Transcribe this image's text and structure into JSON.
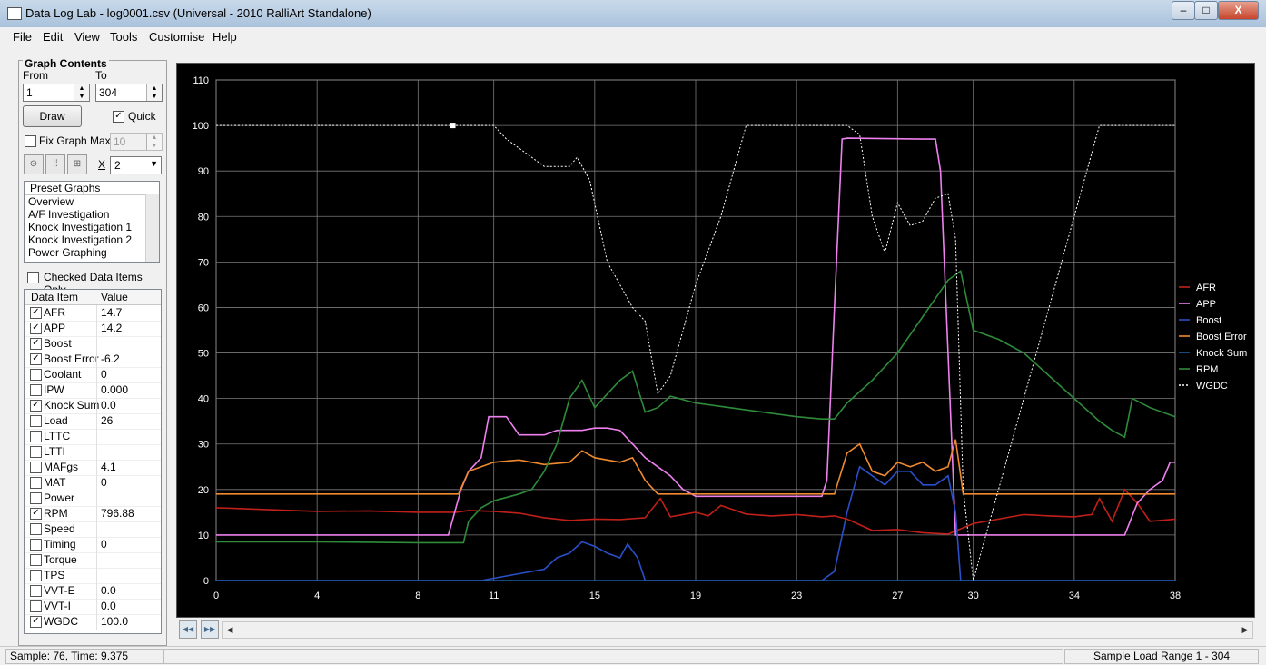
{
  "window": {
    "title": "Data Log Lab - log0001.csv (Universal - 2010 RalliArt Standalone)",
    "min_label": "–",
    "max_label": "□",
    "close_label": "X"
  },
  "menu": [
    "File",
    "Edit",
    "View",
    "Tools",
    "Customise",
    "Help"
  ],
  "graph_contents": {
    "title": "Graph Contents",
    "from_label": "From",
    "from_value": "1",
    "to_label": "To",
    "to_value": "304",
    "draw_label": "Draw",
    "quick_label": "Quick",
    "quick_checked": true,
    "fix_graph_max_label": "Fix Graph Max",
    "fix_graph_max_checked": false,
    "fix_graph_max_value": "10",
    "x_label": "X",
    "x_value": "2",
    "preset_header": "Preset Graphs",
    "presets": [
      "Overview",
      "A/F Investigation",
      "Knock Investigation 1",
      "Knock Investigation 2",
      "Power Graphing"
    ],
    "checked_only_label": "Checked Data Items Only",
    "checked_only": false
  },
  "table": {
    "col_item": "Data Item",
    "col_value": "Value",
    "rows": [
      {
        "name": "AFR",
        "checked": true,
        "value": "14.7"
      },
      {
        "name": "APP",
        "checked": true,
        "value": "14.2"
      },
      {
        "name": "Boost",
        "checked": true,
        "value": ""
      },
      {
        "name": "Boost Error",
        "checked": true,
        "value": "-6.2"
      },
      {
        "name": "Coolant",
        "checked": false,
        "value": "0"
      },
      {
        "name": "IPW",
        "checked": false,
        "value": "0.000"
      },
      {
        "name": "Knock Sum",
        "checked": true,
        "value": "0.0"
      },
      {
        "name": "Load",
        "checked": false,
        "value": "26"
      },
      {
        "name": "LTTC",
        "checked": false,
        "value": ""
      },
      {
        "name": "LTTI",
        "checked": false,
        "value": ""
      },
      {
        "name": "MAFgs",
        "checked": false,
        "value": "4.1"
      },
      {
        "name": "MAT",
        "checked": false,
        "value": "0"
      },
      {
        "name": "Power",
        "checked": false,
        "value": ""
      },
      {
        "name": "RPM",
        "checked": true,
        "value": "796.88"
      },
      {
        "name": "Speed",
        "checked": false,
        "value": ""
      },
      {
        "name": "Timing",
        "checked": false,
        "value": "0"
      },
      {
        "name": "Torque",
        "checked": false,
        "value": ""
      },
      {
        "name": "TPS",
        "checked": false,
        "value": ""
      },
      {
        "name": "VVT-E",
        "checked": false,
        "value": "0.0"
      },
      {
        "name": "VVT-I",
        "checked": false,
        "value": "0.0"
      },
      {
        "name": "WGDC",
        "checked": true,
        "value": "100.0"
      }
    ]
  },
  "status": {
    "left": "Sample: 76, Time: 9.375",
    "right": "Sample Load Range 1 - 304"
  },
  "chart_data": {
    "type": "line",
    "x_ticks": [
      "0",
      "4",
      "8",
      "11",
      "15",
      "19",
      "23",
      "27",
      "30",
      "34",
      "38"
    ],
    "y_ticks": [
      "0",
      "10",
      "20",
      "30",
      "40",
      "50",
      "60",
      "70",
      "80",
      "90",
      "100",
      "110"
    ],
    "xlim": [
      0,
      38
    ],
    "ylim": [
      0,
      110
    ],
    "grid": true,
    "legend_position": "right",
    "series": [
      {
        "name": "AFR",
        "color": "#c0201a",
        "points": [
          [
            0,
            16
          ],
          [
            2,
            15.6
          ],
          [
            4,
            15.2
          ],
          [
            6,
            15.3
          ],
          [
            8,
            15
          ],
          [
            9.5,
            15
          ],
          [
            10,
            15.4
          ],
          [
            11,
            15.2
          ],
          [
            12,
            14.8
          ],
          [
            13,
            13.8
          ],
          [
            14,
            13.2
          ],
          [
            15,
            13.5
          ],
          [
            16,
            13.4
          ],
          [
            17,
            13.8
          ],
          [
            17.6,
            18
          ],
          [
            18,
            14
          ],
          [
            19,
            15
          ],
          [
            19.5,
            14.2
          ],
          [
            20,
            16.5
          ],
          [
            21,
            14.6
          ],
          [
            22,
            14.2
          ],
          [
            23,
            14.5
          ],
          [
            24,
            14
          ],
          [
            24.5,
            14.2
          ],
          [
            25,
            13.5
          ],
          [
            26,
            11
          ],
          [
            27,
            11.2
          ],
          [
            28,
            10.5
          ],
          [
            29,
            10.2
          ],
          [
            30,
            12.5
          ],
          [
            31,
            13.5
          ],
          [
            32,
            14.5
          ],
          [
            33,
            14.2
          ],
          [
            34,
            14
          ],
          [
            34.7,
            14.5
          ],
          [
            35,
            18
          ],
          [
            35.5,
            13
          ],
          [
            36,
            20
          ],
          [
            36.5,
            17
          ],
          [
            37,
            13
          ],
          [
            38,
            13.5
          ]
        ]
      },
      {
        "name": "APP",
        "color": "#ee80ee",
        "points": [
          [
            0,
            10
          ],
          [
            9.2,
            10
          ],
          [
            9.7,
            20
          ],
          [
            10,
            24
          ],
          [
            10.5,
            27
          ],
          [
            10.8,
            36
          ],
          [
            11.5,
            36
          ],
          [
            12,
            32
          ],
          [
            13,
            32
          ],
          [
            13.5,
            33
          ],
          [
            14.5,
            33
          ],
          [
            15,
            33.5
          ],
          [
            15.5,
            33.5
          ],
          [
            16,
            33
          ],
          [
            16.5,
            30
          ],
          [
            17,
            27
          ],
          [
            17.5,
            25
          ],
          [
            18,
            23
          ],
          [
            18.5,
            20
          ],
          [
            19,
            18.5
          ],
          [
            21,
            18.5
          ],
          [
            24,
            18.5
          ],
          [
            24.2,
            22
          ],
          [
            24.5,
            60
          ],
          [
            24.8,
            97
          ],
          [
            25,
            97.2
          ],
          [
            28,
            97
          ],
          [
            28.5,
            97
          ],
          [
            28.7,
            90
          ],
          [
            29,
            50
          ],
          [
            29.3,
            10
          ],
          [
            31,
            10
          ],
          [
            33,
            10
          ],
          [
            35,
            10
          ],
          [
            36,
            10
          ],
          [
            36.5,
            17
          ],
          [
            37,
            20
          ],
          [
            37.5,
            22
          ],
          [
            37.8,
            26
          ],
          [
            38,
            26
          ]
        ]
      },
      {
        "name": "Boost",
        "color": "#2a4fc8",
        "points": [
          [
            0,
            0
          ],
          [
            10.5,
            0
          ],
          [
            11,
            0.5
          ],
          [
            12,
            1.5
          ],
          [
            13,
            2.5
          ],
          [
            13.5,
            5
          ],
          [
            14,
            6
          ],
          [
            14.5,
            8.5
          ],
          [
            15,
            7.5
          ],
          [
            15.5,
            6
          ],
          [
            16,
            5
          ],
          [
            16.3,
            8
          ],
          [
            16.7,
            5
          ],
          [
            17,
            0
          ],
          [
            24,
            0
          ],
          [
            24.5,
            2
          ],
          [
            25,
            15
          ],
          [
            25.5,
            25
          ],
          [
            26,
            23
          ],
          [
            26.5,
            21
          ],
          [
            27,
            24
          ],
          [
            27.5,
            24
          ],
          [
            28,
            21
          ],
          [
            28.5,
            21
          ],
          [
            29,
            23
          ],
          [
            29.3,
            15
          ],
          [
            29.5,
            0
          ],
          [
            38,
            0
          ]
        ]
      },
      {
        "name": "Boost Error",
        "color": "#f08a30",
        "points": [
          [
            0,
            19
          ],
          [
            9.6,
            19
          ],
          [
            10,
            24
          ],
          [
            11,
            26
          ],
          [
            12,
            26.5
          ],
          [
            13,
            25.5
          ],
          [
            14,
            26
          ],
          [
            14.5,
            28.5
          ],
          [
            15,
            27
          ],
          [
            15.5,
            26.5
          ],
          [
            16,
            26
          ],
          [
            16.5,
            27
          ],
          [
            17,
            22
          ],
          [
            17.5,
            19
          ],
          [
            24,
            19
          ],
          [
            24.5,
            19
          ],
          [
            25,
            28
          ],
          [
            25.5,
            30
          ],
          [
            26,
            24
          ],
          [
            26.5,
            23
          ],
          [
            27,
            26
          ],
          [
            27.5,
            25
          ],
          [
            28,
            26
          ],
          [
            28.5,
            24
          ],
          [
            29,
            25
          ],
          [
            29.3,
            31
          ],
          [
            29.6,
            19
          ],
          [
            38,
            19
          ]
        ]
      },
      {
        "name": "Knock Sum",
        "color": "#1e5ca8",
        "points": [
          [
            0,
            0
          ],
          [
            38,
            0
          ]
        ]
      },
      {
        "name": "RPM",
        "color": "#2e8b3a",
        "points": [
          [
            0,
            8.5
          ],
          [
            4,
            8.5
          ],
          [
            8,
            8.3
          ],
          [
            9.8,
            8.3
          ],
          [
            10,
            13
          ],
          [
            10.5,
            16
          ],
          [
            11,
            17.5
          ],
          [
            12,
            19
          ],
          [
            12.5,
            20
          ],
          [
            13,
            24
          ],
          [
            13.5,
            30
          ],
          [
            14,
            40
          ],
          [
            14.5,
            44
          ],
          [
            15,
            38
          ],
          [
            15.5,
            41
          ],
          [
            16,
            44
          ],
          [
            16.5,
            46
          ],
          [
            17,
            37
          ],
          [
            17.5,
            38
          ],
          [
            18,
            40.5
          ],
          [
            19,
            39
          ],
          [
            21,
            37.5
          ],
          [
            23,
            36
          ],
          [
            24,
            35.5
          ],
          [
            24.5,
            35.5
          ],
          [
            25,
            39
          ],
          [
            26,
            44
          ],
          [
            27,
            50
          ],
          [
            28,
            58
          ],
          [
            29,
            66
          ],
          [
            29.5,
            68
          ],
          [
            30,
            55
          ],
          [
            31,
            53
          ],
          [
            32,
            50
          ],
          [
            33,
            45
          ],
          [
            34,
            40
          ],
          [
            35,
            35
          ],
          [
            35.5,
            33
          ],
          [
            36,
            31.5
          ],
          [
            36.3,
            40
          ],
          [
            37,
            38
          ],
          [
            38,
            36
          ]
        ]
      },
      {
        "name": "WGDC",
        "color": "#ffffff",
        "dashed": true,
        "points": [
          [
            0,
            100
          ],
          [
            11,
            100
          ],
          [
            11.5,
            97
          ],
          [
            12,
            95
          ],
          [
            13,
            91
          ],
          [
            14,
            91
          ],
          [
            14.3,
            93
          ],
          [
            14.8,
            88
          ],
          [
            15.5,
            70
          ],
          [
            16.5,
            60
          ],
          [
            17,
            57
          ],
          [
            17.5,
            41
          ],
          [
            18,
            45
          ],
          [
            18.5,
            55
          ],
          [
            19,
            65
          ],
          [
            20,
            80
          ],
          [
            21,
            100
          ],
          [
            25,
            100
          ],
          [
            25.5,
            98
          ],
          [
            26,
            80
          ],
          [
            26.5,
            72
          ],
          [
            27,
            83
          ],
          [
            27.5,
            78
          ],
          [
            28,
            79
          ],
          [
            28.5,
            84
          ],
          [
            29,
            85
          ],
          [
            29.3,
            75
          ],
          [
            29.6,
            20
          ],
          [
            30,
            0
          ],
          [
            30.5,
            10
          ],
          [
            31,
            20
          ],
          [
            32,
            40
          ],
          [
            33,
            60
          ],
          [
            34,
            80
          ],
          [
            35,
            100
          ],
          [
            38,
            100
          ]
        ]
      }
    ],
    "marker": {
      "x": 9.375,
      "y": 100
    }
  }
}
